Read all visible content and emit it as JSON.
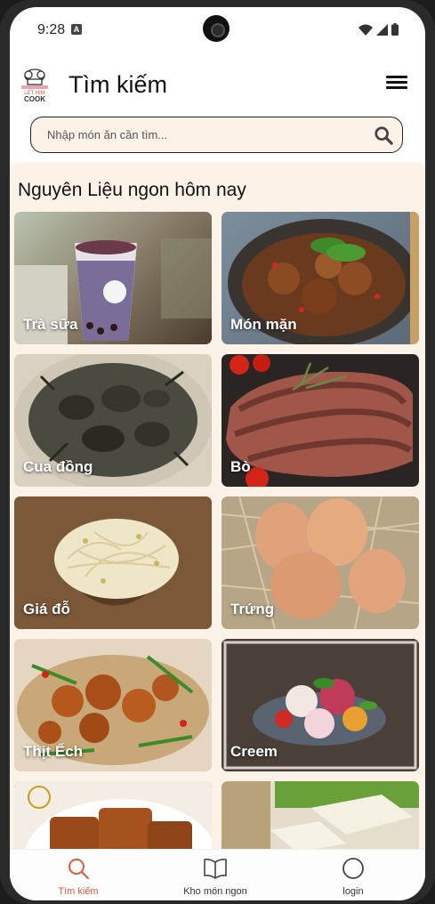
{
  "status_bar": {
    "time": "9:28",
    "notification_icon": "a-icon",
    "icons": [
      "wifi-icon",
      "signal-icon",
      "battery-icon"
    ]
  },
  "app_bar": {
    "logo_text_line1": "LET HIM",
    "logo_text_line2": "COOK",
    "title": "Tìm kiếm",
    "menu_icon": "hamburger-menu-icon"
  },
  "search": {
    "placeholder": "Nhập món ăn cần tìm...",
    "icon": "search-icon"
  },
  "section": {
    "title": "Nguyên Liệu ngon hôm nay"
  },
  "categories": [
    {
      "label": "Trà sữa"
    },
    {
      "label": "Món mặn"
    },
    {
      "label": "Cua đồng"
    },
    {
      "label": "Bò"
    },
    {
      "label": "Giá đỗ"
    },
    {
      "label": "Trứng"
    },
    {
      "label": "Thịt Ếch"
    },
    {
      "label": "Creem"
    },
    {
      "label": ""
    },
    {
      "label": ""
    }
  ],
  "bottom_nav": {
    "items": [
      {
        "label": "Tìm kiếm",
        "icon": "search-icon",
        "active": true
      },
      {
        "label": "Kho món ngon",
        "icon": "book-icon",
        "active": false
      },
      {
        "label": "login",
        "icon": "circle-icon",
        "active": false
      }
    ]
  },
  "colors": {
    "accent": "#e8553d",
    "background": "#fdf2e8"
  }
}
